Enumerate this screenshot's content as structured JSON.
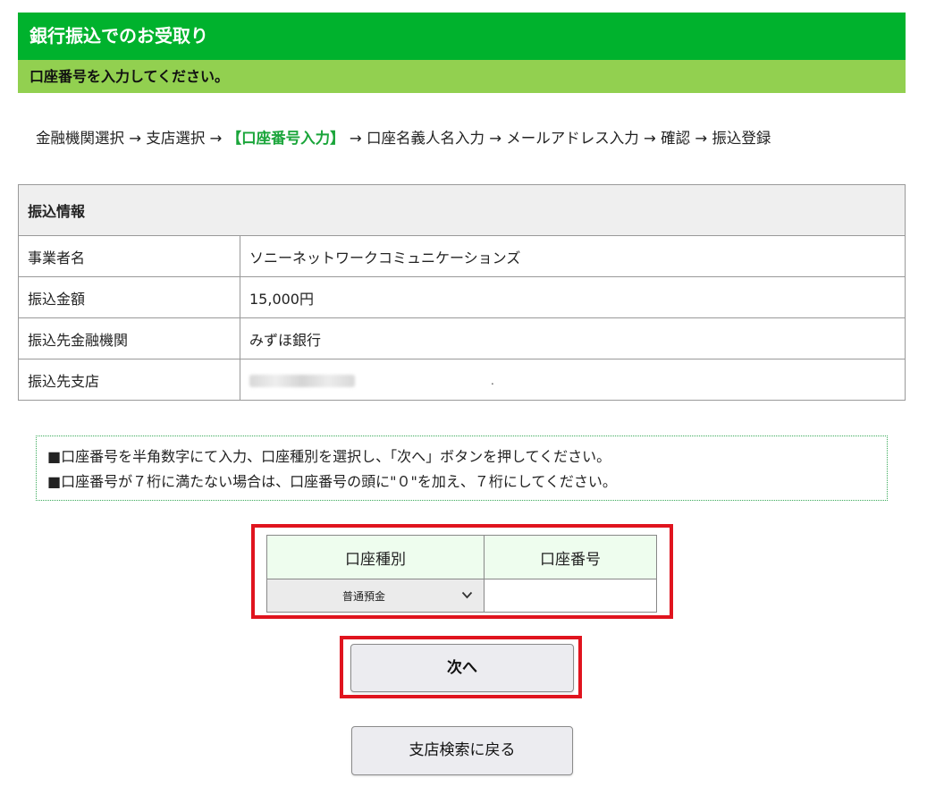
{
  "header": {
    "title": "銀行振込でのお受取り",
    "subtitle": "口座番号を入力してください。"
  },
  "steps": {
    "before": "金融機関選択 → 支店選択 → ",
    "current": "【口座番号入力】",
    "after": " → 口座名義人名入力 → メールアドレス入力 → 確認 → 振込登録"
  },
  "info": {
    "heading": "振込情報",
    "rows": [
      {
        "label": "事業者名",
        "value": "ソニーネットワークコミュニケーションズ"
      },
      {
        "label": "振込金額",
        "value": "15,000円"
      },
      {
        "label": "振込先金融機関",
        "value": "みずほ銀行"
      },
      {
        "label": "振込先支店",
        "value": "."
      }
    ]
  },
  "notice": {
    "lines": [
      "■口座番号を半角数字にて入力、口座種別を選択し、「次へ」ボタンを押してください。",
      "■口座番号が７桁に満たない場合は、口座番号の頭に\"０\"を加え、７桁にしてください。"
    ]
  },
  "form": {
    "type_header": "口座種別",
    "number_header": "口座番号",
    "type_value": "普通預金",
    "number_value": ""
  },
  "buttons": {
    "next": "次へ",
    "back": "支店検索に戻る"
  },
  "icons": {
    "select_arrow": "chevron-down-icon"
  },
  "colors": {
    "header_bg": "#00b22d",
    "subheader_bg": "#92d050",
    "current_step": "#1aa53a",
    "highlight_border": "#e0141e"
  }
}
